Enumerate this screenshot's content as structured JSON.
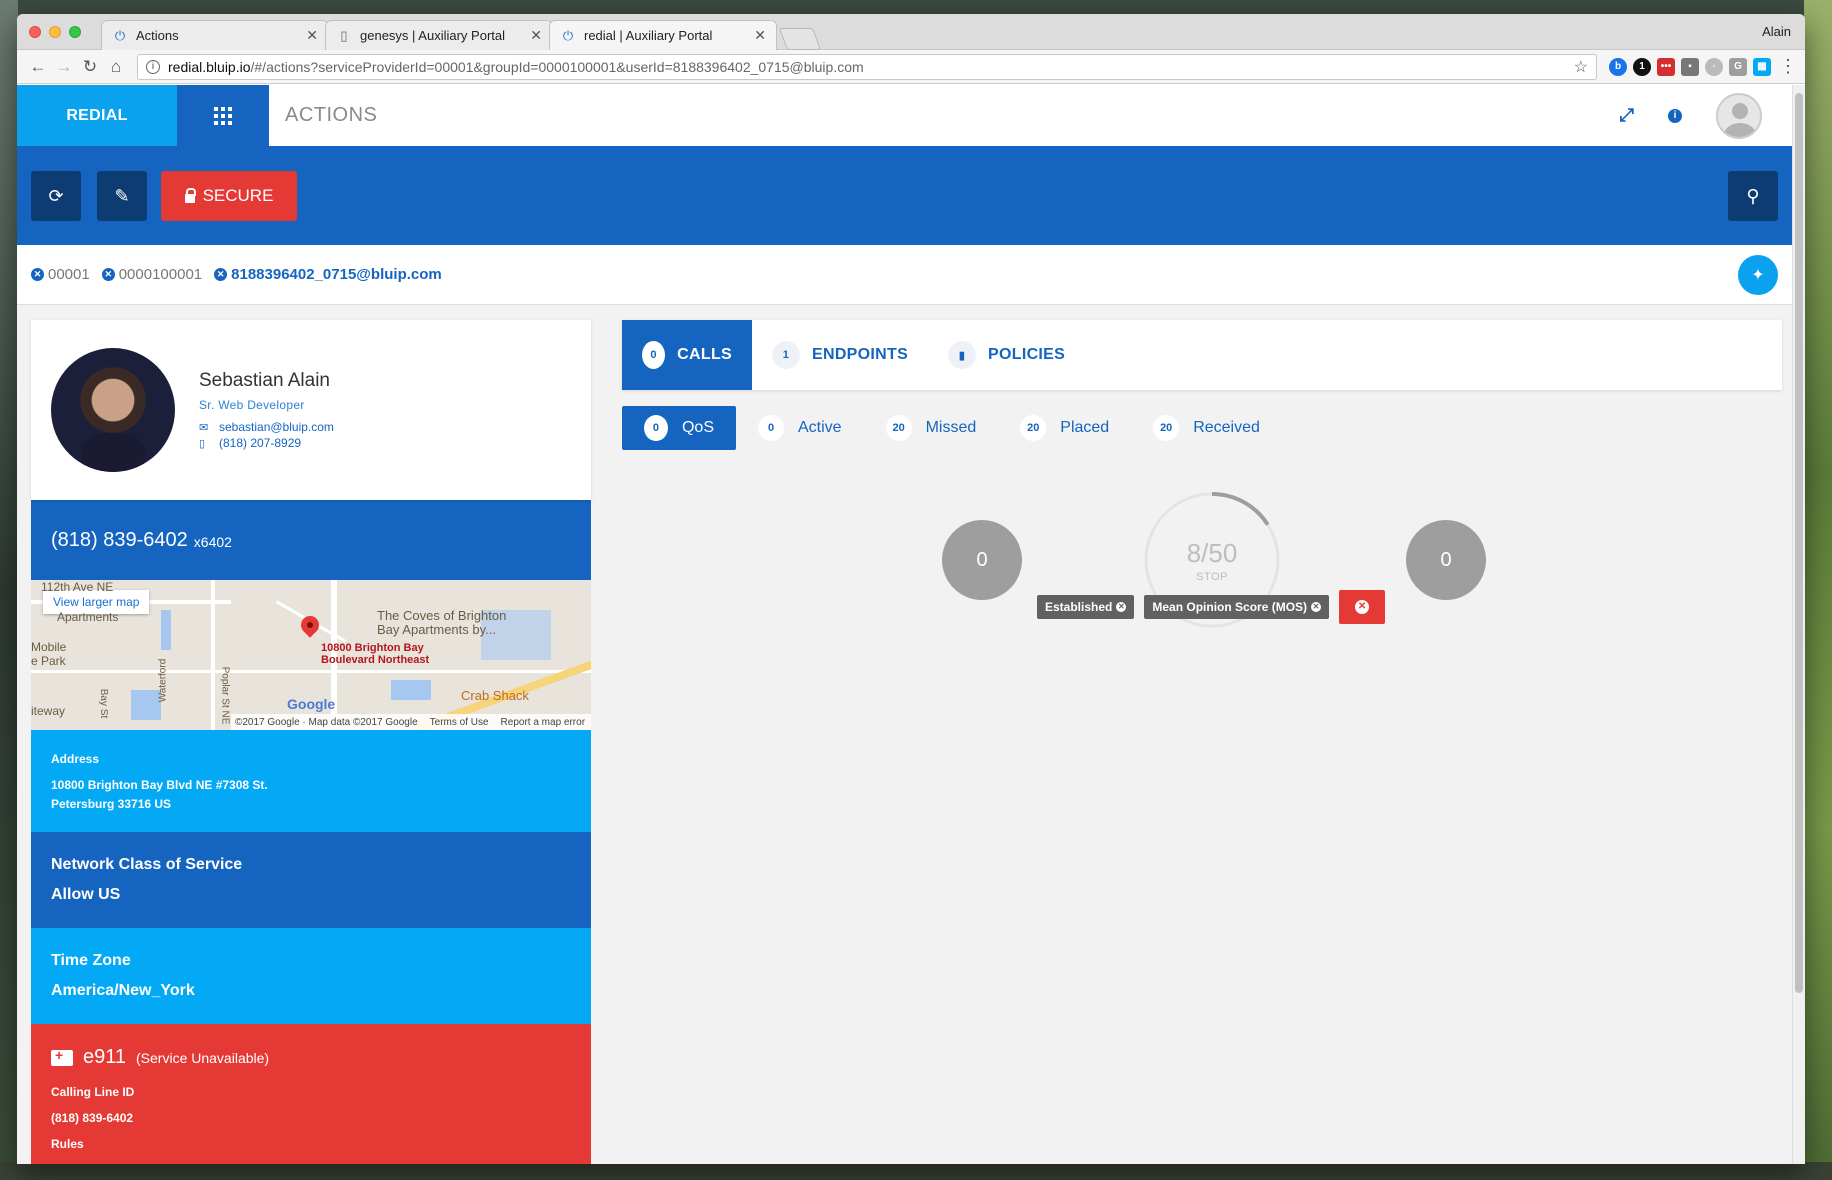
{
  "browser": {
    "tabs": [
      {
        "title": "Actions",
        "icon": "power-icon"
      },
      {
        "title": "genesys | Auxiliary Portal",
        "icon": "document-icon"
      },
      {
        "title": "redial | Auxiliary Portal",
        "icon": "power-icon"
      }
    ],
    "profile": "Alain",
    "url_host": "redial.bluip.io",
    "url_path": "/#/actions?serviceProviderId=00001&groupId=0000100001&userId=8188396402_0715@bluip.com"
  },
  "header": {
    "brand": "REDIAL",
    "page_title": "ACTIONS"
  },
  "toolbar": {
    "secure_label": "SECURE"
  },
  "breadcrumb": {
    "service_provider": "00001",
    "group": "0000100001",
    "user": "8188396402_0715@bluip.com"
  },
  "profile": {
    "name": "Sebastian Alain",
    "title": "Sr. Web Developer",
    "email": "sebastian@bluip.com",
    "phone": "(818) 207-8929",
    "main_number": "(818) 839-6402",
    "extension": "x6402"
  },
  "map": {
    "link": "View larger map",
    "pin_label_1": "10800 Brighton Bay",
    "pin_label_2": "Boulevard Northeast",
    "place_1": "The Coves of Brighton",
    "place_2": "Bay Apartments by...",
    "place_3": "Crab Shack",
    "place_4": "Mobile",
    "place_5": "e Park",
    "place_6": "Apartments",
    "place_7": "iteway",
    "street_1": "112th Ave NE",
    "street_2": "Waterford",
    "street_3": "Poplar St NE",
    "street_4": "Bay St",
    "google": "Google",
    "footer_1": "©2017 Google · Map data ©2017 Google",
    "footer_2": "Terms of Use",
    "footer_3": "Report a map error"
  },
  "address": {
    "label": "Address",
    "line1": "10800 Brighton Bay Blvd NE #7308 St.",
    "line2": "Petersburg 33716 US"
  },
  "ncos": {
    "label": "Network Class of Service",
    "value": "Allow US"
  },
  "timezone": {
    "label": "Time Zone",
    "value": "America/New_York"
  },
  "e911": {
    "title": "e911",
    "status": "(Service Unavailable)",
    "calling_line_label": "Calling Line ID",
    "calling_line_value": "(818) 839-6402",
    "rules_label": "Rules"
  },
  "main_tabs": [
    {
      "label": "CALLS",
      "count": "0"
    },
    {
      "label": "ENDPOINTS",
      "count": "1"
    },
    {
      "label": "POLICIES",
      "count": ""
    }
  ],
  "sub_tabs": [
    {
      "label": "QoS",
      "count": "0"
    },
    {
      "label": "Active",
      "count": "0"
    },
    {
      "label": "Missed",
      "count": "20"
    },
    {
      "label": "Placed",
      "count": "20"
    },
    {
      "label": "Received",
      "count": "20"
    }
  ],
  "gauges": {
    "left_value": "0",
    "right_value": "0",
    "progress_text": "8/50",
    "progress_fraction": 0.16,
    "stop_label": "STOP"
  },
  "filters": [
    {
      "label": "Established"
    },
    {
      "label": "Mean Opinion Score (MOS)"
    }
  ],
  "colors": {
    "primary": "#1565c0",
    "accent": "#03a9f4",
    "danger": "#e53935"
  }
}
